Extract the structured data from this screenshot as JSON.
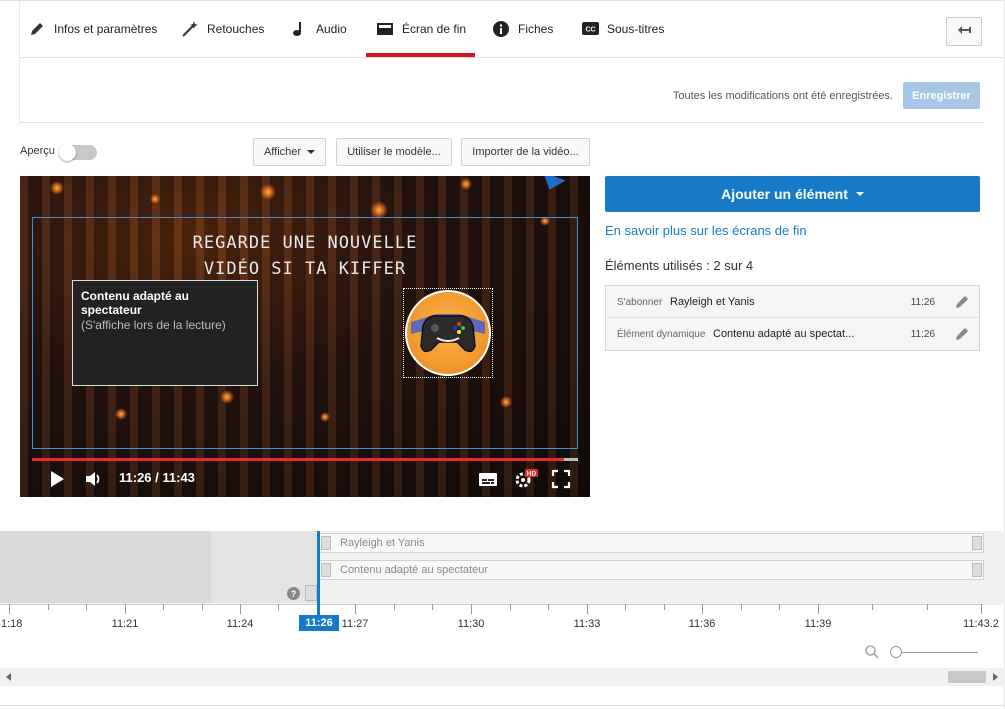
{
  "tabs": [
    {
      "label": "Infos et paramètres",
      "icon": "pencil-icon"
    },
    {
      "label": "Retouches",
      "icon": "magic-wand-icon"
    },
    {
      "label": "Audio",
      "icon": "music-note-icon"
    },
    {
      "label": "Écran de fin",
      "icon": "end-screen-icon",
      "active": true
    },
    {
      "label": "Fiches",
      "icon": "info-icon"
    },
    {
      "label": "Sous-titres",
      "icon": "cc-icon"
    }
  ],
  "save": {
    "status": "Toutes les modifications ont été enregistrées.",
    "button": "Enregistrer"
  },
  "toolbar": {
    "preview_label": "Aperçu",
    "show_button": "Afficher",
    "template_button": "Utiliser le modèle...",
    "import_button": "Importer de la vidéo..."
  },
  "video": {
    "title_line1": "REGARDE UNE NOUVELLE",
    "title_line2": "VIDÉO SI TA KIFFER",
    "element_title": "Contenu adapté au spectateur",
    "element_subtitle": "(S'affiche lors de la lecture)",
    "time": "11:26 / 11:43",
    "progress": 0.974,
    "hd_badge": "HD"
  },
  "panel": {
    "add_button": "Ajouter un élément",
    "learn_more": "En savoir plus sur les écrans de fin",
    "used_count": "Éléments utilisés : 2 sur 4",
    "elements": [
      {
        "type": "S'abonner",
        "name": "Rayleigh et Yanis",
        "time": "11:26"
      },
      {
        "type": "Élément dynamique",
        "name": "Contenu adapté au spectat...",
        "time": "11:26"
      }
    ]
  },
  "timeline": {
    "tracks": [
      "Rayleigh et Yanis",
      "Contenu adapté au spectateur"
    ],
    "help": "?",
    "playhead": "11:26",
    "ticks": [
      "1:18",
      "11:21",
      "11:24",
      "11:27",
      "11:30",
      "11:33",
      "11:36",
      "11:39",
      "11:43.2"
    ]
  },
  "colors": {
    "accent": "#167ac6",
    "tab_active": "#cc181e",
    "save_disabled": "#a7c7e7"
  }
}
